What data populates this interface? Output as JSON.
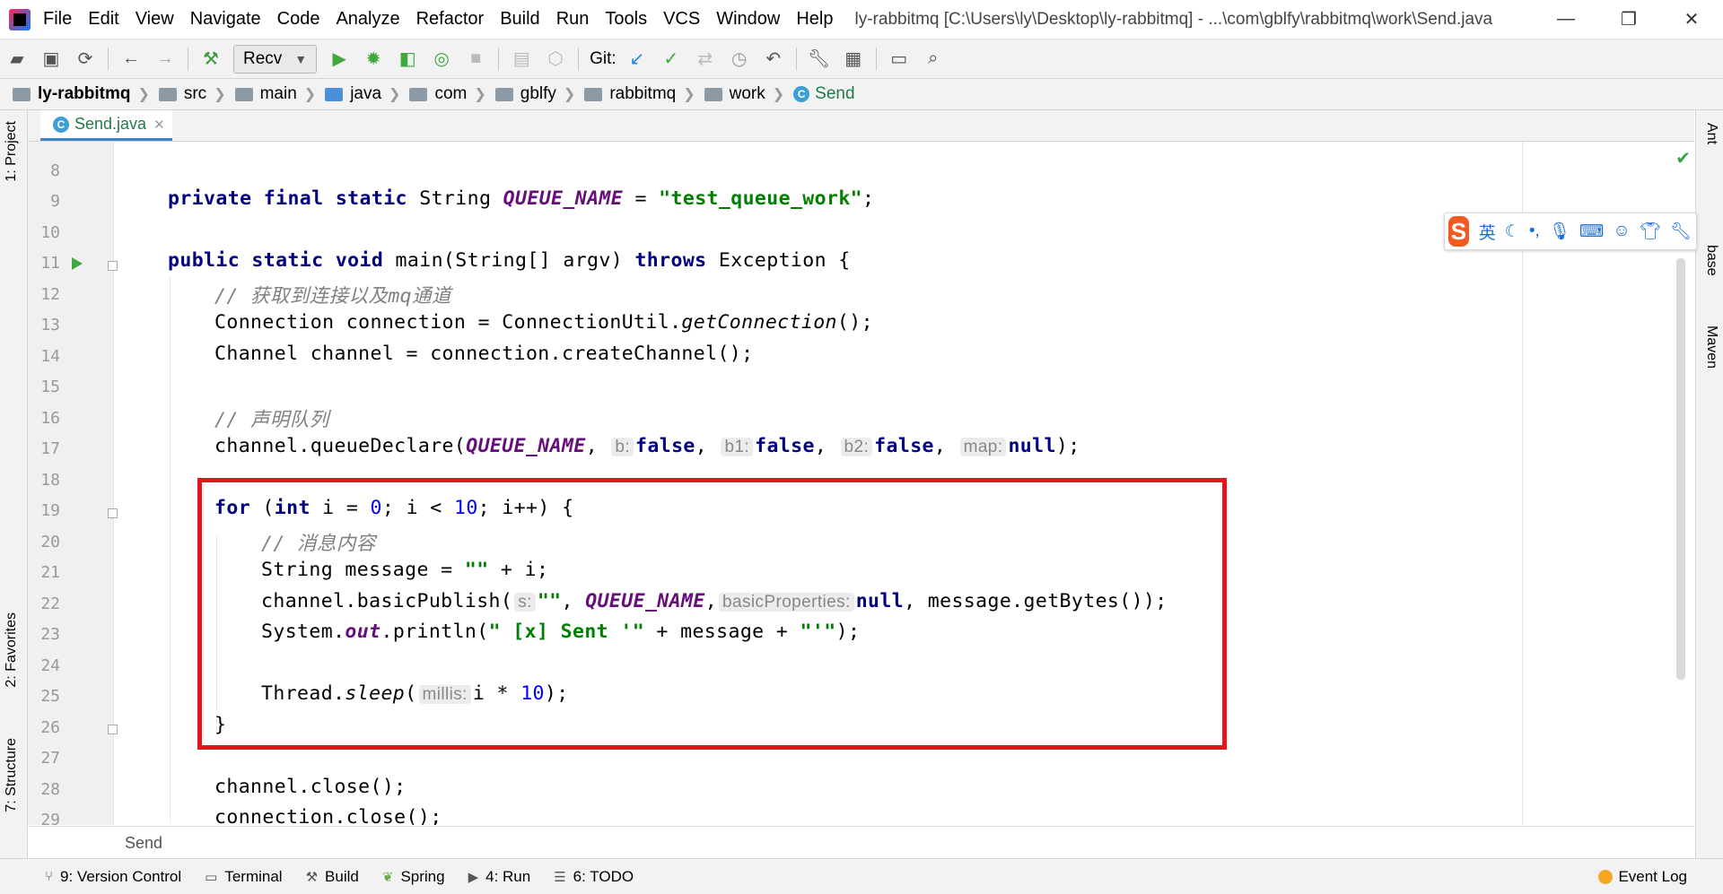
{
  "menubar": {
    "items": [
      "File",
      "Edit",
      "View",
      "Navigate",
      "Code",
      "Analyze",
      "Refactor",
      "Build",
      "Run",
      "Tools",
      "VCS",
      "Window",
      "Help"
    ],
    "title": "ly-rabbitmq [C:\\Users\\ly\\Desktop\\ly-rabbitmq] - ...\\com\\gblfy\\rabbitmq\\work\\Send.java"
  },
  "toolbar": {
    "run_config": "Recv",
    "git_label": "Git:"
  },
  "breadcrumb": [
    "ly-rabbitmq",
    "src",
    "main",
    "java",
    "com",
    "gblfy",
    "rabbitmq",
    "work",
    "Send"
  ],
  "tab": {
    "label": "Send.java"
  },
  "left_tabs": {
    "project": "1: Project",
    "favorites": "2: Favorites",
    "structure": "7: Structure"
  },
  "right_tabs": {
    "ant": "Ant",
    "database": "base",
    "maven": "Maven"
  },
  "ime": {
    "lang": "英"
  },
  "editor": {
    "line_numbers": [
      "8",
      "9",
      "10",
      "11",
      "12",
      "13",
      "14",
      "15",
      "16",
      "17",
      "18",
      "19",
      "20",
      "21",
      "22",
      "23",
      "24",
      "25",
      "26",
      "27",
      "28",
      "29"
    ],
    "lines": {
      "l9": {
        "kw": "private final static",
        "type": " String ",
        "field": "QUEUE_NAME",
        "eq": " = ",
        "str": "\"test_queue_work\"",
        "end": ";"
      },
      "l11": {
        "kw": "public static void",
        "sig": " main(String[] argv) ",
        "throws": "throws",
        "rest": " Exception {"
      },
      "l12": "// 获取到连接以及mq通道",
      "l13": {
        "a": "Connection connection = ConnectionUtil.",
        "b": "getConnection",
        "c": "();"
      },
      "l14": "Channel channel = connection.createChannel();",
      "l16": "// 声明队列",
      "l17": {
        "a": "channel.queueDeclare(",
        "field": "QUEUE_NAME",
        "h1": "b:",
        "v1": "false",
        "h2": "b1:",
        "v2": "false",
        "h3": "b2:",
        "v3": "false",
        "h4": "map:",
        "v4": "null",
        "end": ");"
      },
      "l19": {
        "for": "for",
        "a": " (",
        "int": "int",
        "b": " i = ",
        "zero": "0",
        "c": "; i < ",
        "ten": "10",
        "d": "; i++) {"
      },
      "l20": "// 消息内容",
      "l21": {
        "a": "String message = ",
        "str": "\"\"",
        "b": " + i;"
      },
      "l22": {
        "a": "channel.basicPublish(",
        "h1": "s:",
        "str": "\"\"",
        "b": ", ",
        "field": "QUEUE_NAME",
        "c": ",",
        "h2": "basicProperties:",
        "null": "null",
        "d": ", message.getBytes());"
      },
      "l23": {
        "a": "System.",
        "out": "out",
        "b": ".println(",
        "str": "\" [x] Sent '\"",
        "c": " + message + ",
        "str2": "\"'\"",
        "d": ");"
      },
      "l25": {
        "a": "Thread.",
        "sleep": "sleep",
        "b": "(",
        "h1": "millis:",
        "c": "i * ",
        "ten": "10",
        "d": ");"
      },
      "l26": "}",
      "l28": "channel.close();",
      "l29": "connection.close();"
    }
  },
  "crumb_line": "Send",
  "bottombar": {
    "version_control": "9: Version Control",
    "terminal": "Terminal",
    "build": "Build",
    "spring": "Spring",
    "run": "4: Run",
    "todo": "6: TODO",
    "event_log": "Event Log"
  }
}
